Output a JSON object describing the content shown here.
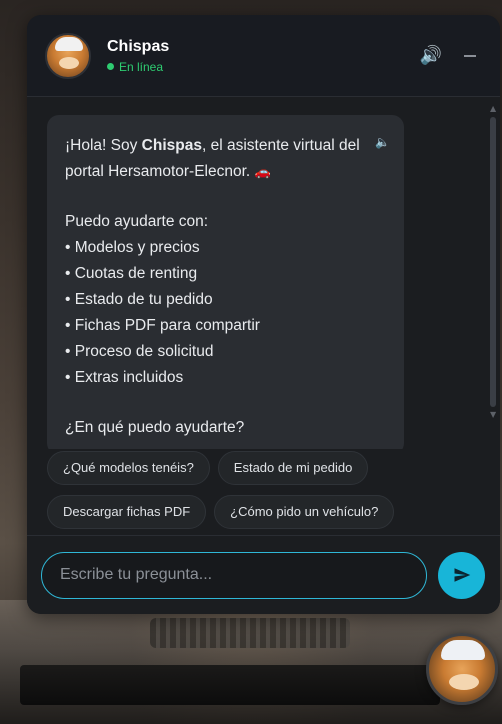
{
  "header": {
    "title": "Chispas",
    "status": "En línea",
    "status_color": "#2ecc71",
    "sound_icon": "speaker-icon",
    "minimize_icon": "minimize-icon"
  },
  "message": {
    "greeting_pre": "¡Hola! Soy ",
    "greeting_name": "Chispas",
    "greeting_post": ", el asistente virtual del portal Hersamotor-Elecnor.",
    "car_emoji": "🚗",
    "intro": "Puedo ayudarte con:",
    "items": [
      "• Modelos y precios",
      "• Cuotas de renting",
      "• Estado de tu pedido",
      "• Fichas PDF para compartir",
      "• Proceso de solicitud",
      "• Extras incluidos"
    ],
    "question": "¿En qué puedo ayudarte?"
  },
  "chips": [
    "¿Qué modelos tenéis?",
    "Estado de mi pedido",
    "Descargar fichas PDF",
    "¿Cómo pido un vehículo?"
  ],
  "composer": {
    "placeholder": "Escribe tu pregunta...",
    "send_icon": "send-icon",
    "accent": "#18b5d8"
  }
}
